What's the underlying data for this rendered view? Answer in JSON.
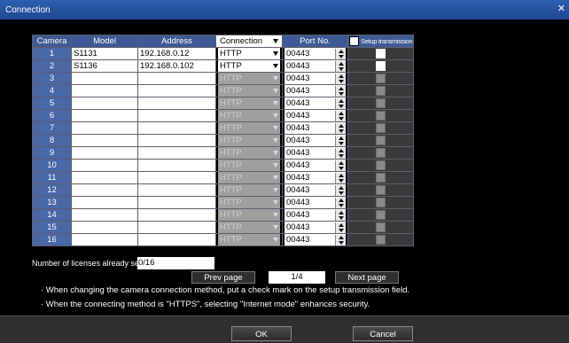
{
  "window": {
    "title": "Connection",
    "close_glyph": "✕"
  },
  "table": {
    "headers": {
      "camera": "Camera",
      "model": "Model",
      "address": "Address",
      "connection": "Connection",
      "port": "Port No.",
      "setup": "Setup transmission"
    },
    "rows": [
      {
        "camera": "1",
        "model": "S1131",
        "address": "192.168.0.12",
        "connection": "HTTP",
        "port": "00443",
        "enabled": true
      },
      {
        "camera": "2",
        "model": "S1136",
        "address": "192.168.0.102",
        "connection": "HTTP",
        "port": "00443",
        "enabled": true
      },
      {
        "camera": "3",
        "model": "",
        "address": "",
        "connection": "HTTP",
        "port": "00443",
        "enabled": false
      },
      {
        "camera": "4",
        "model": "",
        "address": "",
        "connection": "HTTP",
        "port": "00443",
        "enabled": false
      },
      {
        "camera": "5",
        "model": "",
        "address": "",
        "connection": "HTTP",
        "port": "00443",
        "enabled": false
      },
      {
        "camera": "6",
        "model": "",
        "address": "",
        "connection": "HTTP",
        "port": "00443",
        "enabled": false
      },
      {
        "camera": "7",
        "model": "",
        "address": "",
        "connection": "HTTP",
        "port": "00443",
        "enabled": false
      },
      {
        "camera": "8",
        "model": "",
        "address": "",
        "connection": "HTTP",
        "port": "00443",
        "enabled": false
      },
      {
        "camera": "9",
        "model": "",
        "address": "",
        "connection": "HTTP",
        "port": "00443",
        "enabled": false
      },
      {
        "camera": "10",
        "model": "",
        "address": "",
        "connection": "HTTP",
        "port": "00443",
        "enabled": false
      },
      {
        "camera": "11",
        "model": "",
        "address": "",
        "connection": "HTTP",
        "port": "00443",
        "enabled": false
      },
      {
        "camera": "12",
        "model": "",
        "address": "",
        "connection": "HTTP",
        "port": "00443",
        "enabled": false
      },
      {
        "camera": "13",
        "model": "",
        "address": "",
        "connection": "HTTP",
        "port": "00443",
        "enabled": false
      },
      {
        "camera": "14",
        "model": "",
        "address": "",
        "connection": "HTTP",
        "port": "00443",
        "enabled": false
      },
      {
        "camera": "15",
        "model": "",
        "address": "",
        "connection": "HTTP",
        "port": "00443",
        "enabled": false
      },
      {
        "camera": "16",
        "model": "",
        "address": "",
        "connection": "HTTP",
        "port": "00443",
        "enabled": false
      }
    ]
  },
  "licenses": {
    "label": "Number of licenses already set",
    "value": "0/16"
  },
  "pagination": {
    "prev": "Prev page",
    "page": "1/4",
    "next": "Next page"
  },
  "notes": [
    "· When changing the camera connection method, put a check mark on the setup transmission field.",
    "· When the connecting method is \"HTTPS\", selecting \"Internet mode\" enhances security."
  ],
  "footer": {
    "ok": "OK",
    "cancel": "Cancel"
  }
}
